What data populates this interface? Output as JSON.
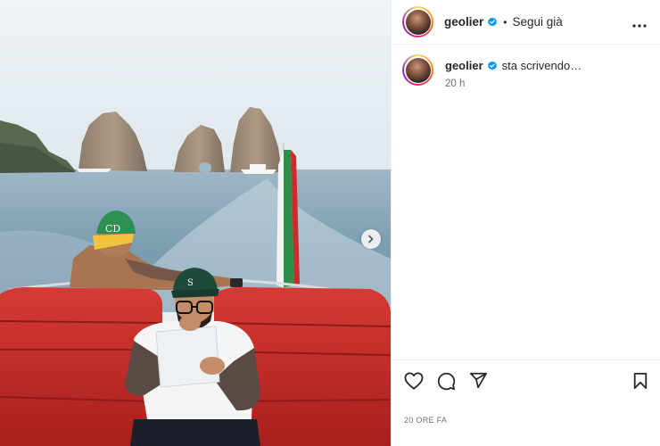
{
  "author": {
    "username": "geolier",
    "follow_status": "Segui già"
  },
  "caption": {
    "username": "geolier",
    "text": "sta scrivendo…",
    "time": "20 h"
  },
  "post": {
    "date_label": "20 ORE FA"
  },
  "icons": {
    "verified": "verified-badge-icon",
    "more": "more-options-icon",
    "next": "chevron-right-icon",
    "like": "heart-icon",
    "comment": "comment-icon",
    "share": "share-icon",
    "save": "bookmark-icon"
  },
  "colors": {
    "verified_blue": "#0095f6",
    "text_primary": "#262626",
    "text_secondary": "#737373",
    "divider": "#efefef"
  }
}
